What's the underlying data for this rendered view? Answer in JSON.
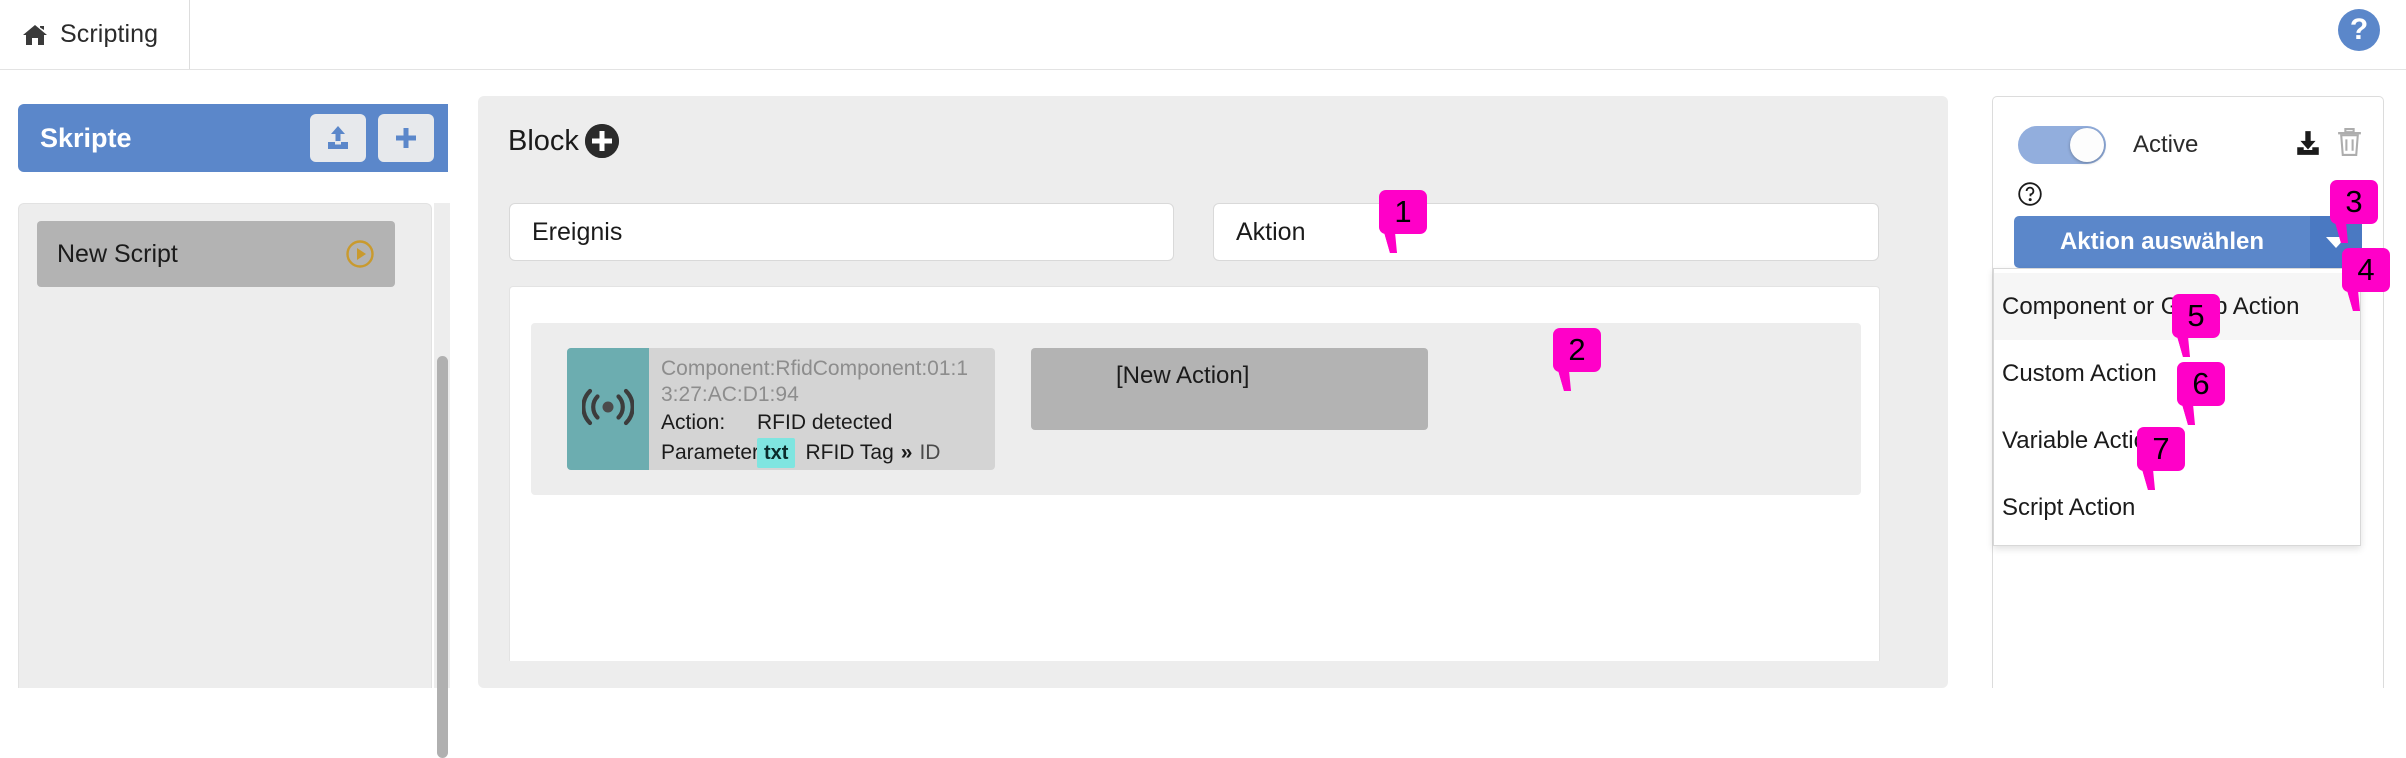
{
  "topbar": {
    "home_icon": "home-icon",
    "breadcrumb": "Scripting",
    "help_label": "?"
  },
  "sidebar": {
    "title": "Skripte",
    "upload_icon": "upload-icon",
    "add_icon": "plus-icon",
    "scripts": [
      {
        "name": "New Script",
        "run_icon": "play-circle-icon"
      }
    ]
  },
  "main": {
    "block_title": "Block",
    "block_add_icon": "plus-circle-icon",
    "fields": {
      "event_label": "Ereignis",
      "action_label": "Aktion"
    },
    "event_card": {
      "icon": "rfid-signal-icon",
      "component": "Component:RfidComponent:01:13:27:AC:D1:94",
      "action_key": "Action:",
      "action_value": "RFID detected",
      "parameters_key": "Parameters:",
      "parameter_type": "txt",
      "parameter_name": "RFID Tag",
      "parameter_separator": "»",
      "parameter_target": "ID"
    },
    "new_action_label": "[New Action]"
  },
  "right_panel": {
    "toggle_state": "on",
    "toggle_label": "Active",
    "download_icon": "download-icon",
    "delete_icon": "trash-icon",
    "help_icon": "question-circle-icon",
    "dropdown_button_label": "Aktion auswählen",
    "dropdown_caret_icon": "chevron-down-icon",
    "menu_items": [
      {
        "label": "Component or Group Action",
        "hovered": true
      },
      {
        "label": "Custom Action",
        "hovered": false
      },
      {
        "label": "Variable Action",
        "hovered": false
      },
      {
        "label": "Script Action",
        "hovered": false
      }
    ]
  },
  "annotations": [
    {
      "id": "1",
      "label": "1"
    },
    {
      "id": "2",
      "label": "2"
    },
    {
      "id": "3",
      "label": "3"
    },
    {
      "id": "4",
      "label": "4"
    },
    {
      "id": "5",
      "label": "5"
    },
    {
      "id": "6",
      "label": "6"
    },
    {
      "id": "7",
      "label": "7"
    }
  ],
  "colors": {
    "accent_blue": "#5b87ca",
    "marker_pink": "#ff00c8",
    "teal_icon_bg": "#6cadb0",
    "chip_cyan": "#7fe5e0",
    "play_gold": "#c99a2e"
  }
}
